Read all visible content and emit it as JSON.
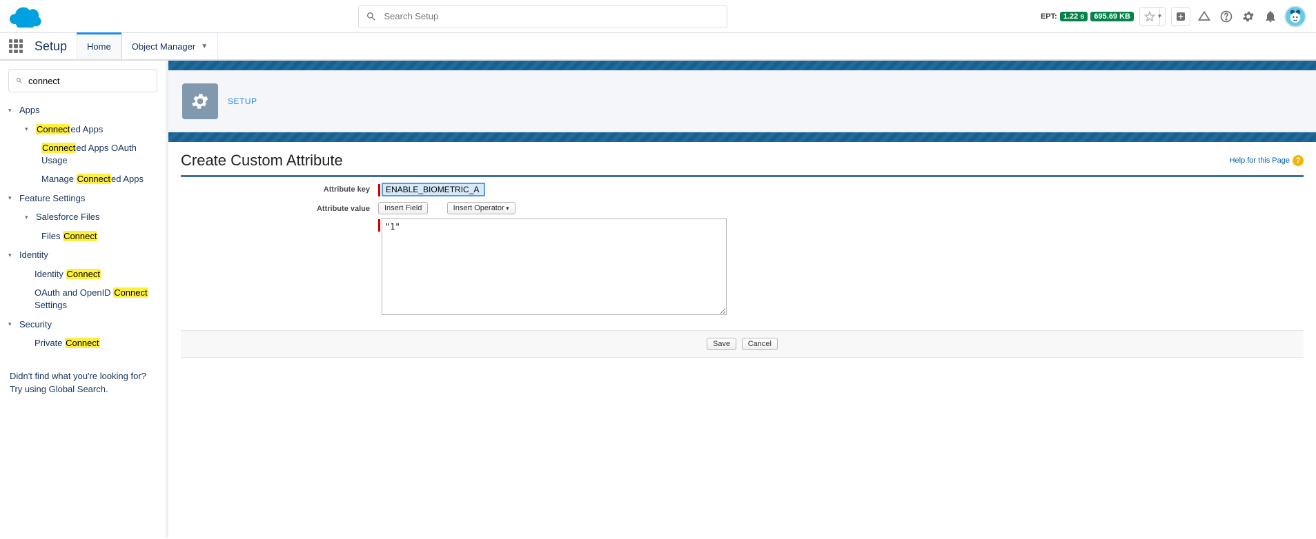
{
  "global_header": {
    "search_placeholder": "Search Setup",
    "ept_label": "EPT:",
    "ept_time": "1.22 s",
    "ept_size": "695.69 KB"
  },
  "context_bar": {
    "app_name": "Setup",
    "tab_home": "Home",
    "tab_object_manager": "Object Manager"
  },
  "sidebar": {
    "quick_find_value": "connect",
    "nodes": {
      "apps": "Apps",
      "connected_apps": {
        "pre": "",
        "hl": "Connect",
        "post": "ed Apps"
      },
      "connected_apps_oauth_usage": {
        "pre": "",
        "hl": "Connect",
        "post": "ed Apps OAuth Usage"
      },
      "manage_connected_apps": {
        "pre": "Manage ",
        "hl": "Connect",
        "post": "ed Apps"
      },
      "feature_settings": "Feature Settings",
      "salesforce_files": "Salesforce Files",
      "files_connect": {
        "pre": "Files ",
        "hl": "Connect",
        "post": ""
      },
      "identity": "Identity",
      "identity_connect": {
        "pre": "Identity ",
        "hl": "Connect",
        "post": ""
      },
      "oauth_openid": {
        "pre": "OAuth and OpenID ",
        "hl": "Connect",
        "post": " Settings"
      },
      "security": "Security",
      "private_connect": {
        "pre": "Private ",
        "hl": "Connect",
        "post": ""
      }
    },
    "footer_line1": "Didn't find what you're looking for?",
    "footer_line2": "Try using Global Search."
  },
  "page_header": {
    "breadcrumb": "SETUP"
  },
  "form": {
    "title": "Create Custom Attribute",
    "help_link": "Help for this Page",
    "label_key": "Attribute key",
    "label_value": "Attribute value",
    "key_value": "ENABLE_BIOMETRIC_A",
    "btn_insert_field": "Insert Field",
    "btn_insert_operator": "Insert Operator",
    "value_text": "\"1\"",
    "btn_save": "Save",
    "btn_cancel": "Cancel"
  }
}
